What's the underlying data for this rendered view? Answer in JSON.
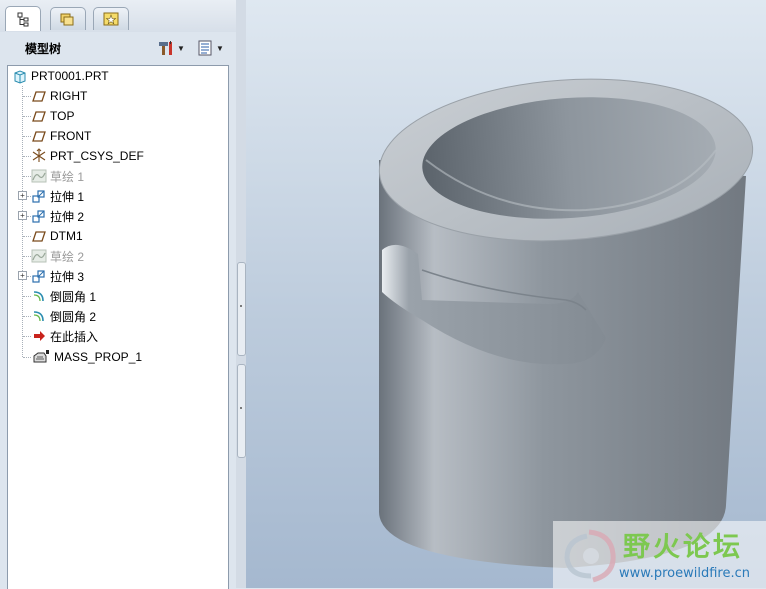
{
  "tabs": [
    {
      "name": "model-tree",
      "icon": "model-tree-tab-icon"
    },
    {
      "name": "folder-browser",
      "icon": "folder-browser-tab-icon"
    },
    {
      "name": "favorites",
      "icon": "favorites-tab-icon"
    }
  ],
  "tree_header": {
    "title": "模型树",
    "settings_icon": "settings-tools-icon",
    "show_icon": "show-list-icon"
  },
  "tree": {
    "root": {
      "label": "PRT0001.PRT",
      "icon": "part-icon"
    },
    "items": [
      {
        "label": "RIGHT",
        "icon": "datum-plane-icon",
        "expandable": false,
        "suppressed": false
      },
      {
        "label": "TOP",
        "icon": "datum-plane-icon",
        "expandable": false,
        "suppressed": false
      },
      {
        "label": "FRONT",
        "icon": "datum-plane-icon",
        "expandable": false,
        "suppressed": false
      },
      {
        "label": "PRT_CSYS_DEF",
        "icon": "coordinate-system-icon",
        "expandable": false,
        "suppressed": false
      },
      {
        "label": "草绘 1",
        "icon": "sketch-icon",
        "expandable": false,
        "suppressed": true
      },
      {
        "label": "拉伸 1",
        "icon": "extrude-icon",
        "expandable": true,
        "suppressed": false
      },
      {
        "label": "拉伸 2",
        "icon": "extrude-icon",
        "expandable": true,
        "suppressed": false
      },
      {
        "label": "DTM1",
        "icon": "datum-plane-icon",
        "expandable": false,
        "suppressed": false
      },
      {
        "label": "草绘 2",
        "icon": "sketch-icon",
        "expandable": false,
        "suppressed": true
      },
      {
        "label": "拉伸 3",
        "icon": "extrude-icon",
        "expandable": true,
        "suppressed": false
      },
      {
        "label": "倒圆角 1",
        "icon": "round-icon",
        "expandable": false,
        "suppressed": false
      },
      {
        "label": "倒圆角 2",
        "icon": "round-icon",
        "expandable": false,
        "suppressed": false
      },
      {
        "label": "在此插入",
        "icon": "insert-here-arrow-icon",
        "expandable": false,
        "suppressed": false
      }
    ],
    "analysis": {
      "label": "MASS_PROP_1",
      "icon": "analysis-feature-icon"
    }
  },
  "watermark": {
    "title": "野火论坛",
    "url": "www.proewildfire.cn"
  },
  "colors": {
    "viewport_top": "#dfe8f1",
    "viewport_bottom": "#a5b8cf",
    "model_gray": "#8e969e",
    "watermark_green": "#7dc850",
    "watermark_blue": "#2a7ab9"
  }
}
